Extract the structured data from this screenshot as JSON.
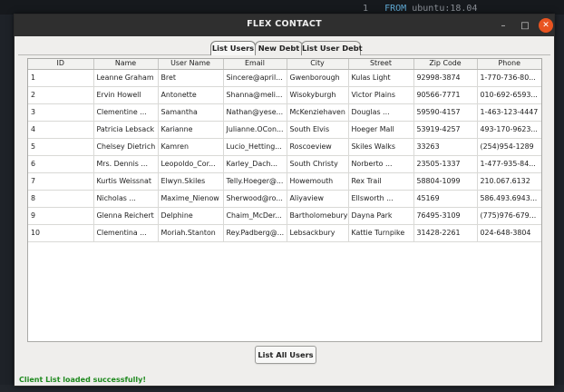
{
  "background": {
    "terminal_line_number": "1",
    "terminal_keyword": "FROM",
    "terminal_text": "ubuntu:18.04"
  },
  "window": {
    "title": "FLEX CONTACT",
    "minimize_label": "–",
    "maximize_label": "□",
    "close_label": "✕"
  },
  "tabs": [
    {
      "label": "List Users",
      "active": true
    },
    {
      "label": "New Debt",
      "active": false
    },
    {
      "label": "List User Debt",
      "active": false
    }
  ],
  "table": {
    "columns": [
      "ID",
      "Name",
      "User Name",
      "Email",
      "City",
      "Street",
      "Zip Code",
      "Phone"
    ],
    "rows": [
      [
        "1",
        "Leanne Graham",
        "Bret",
        "Sincere@april...",
        "Gwenborough",
        "Kulas Light",
        "92998-3874",
        "1-770-736-80..."
      ],
      [
        "2",
        "Ervin Howell",
        "Antonette",
        "Shanna@meli...",
        "Wisokyburgh",
        "Victor Plains",
        "90566-7771",
        "010-692-6593..."
      ],
      [
        "3",
        "Clementine ...",
        "Samantha",
        "Nathan@yese...",
        "McKenziehaven",
        "Douglas ...",
        "59590-4157",
        "1-463-123-4447"
      ],
      [
        "4",
        "Patricia Lebsack",
        "Karianne",
        "Julianne.OCon...",
        "South Elvis",
        "Hoeger Mall",
        "53919-4257",
        "493-170-9623..."
      ],
      [
        "5",
        "Chelsey Dietrich",
        "Kamren",
        "Lucio_Hetting...",
        "Roscoeview",
        "Skiles Walks",
        "33263",
        "(254)954-1289"
      ],
      [
        "6",
        "Mrs. Dennis ...",
        "Leopoldo_Cor...",
        "Karley_Dach...",
        "South Christy",
        "Norberto ...",
        "23505-1337",
        "1-477-935-84..."
      ],
      [
        "7",
        "Kurtis Weissnat",
        "Elwyn.Skiles",
        "Telly.Hoeger@...",
        "Howemouth",
        "Rex Trail",
        "58804-1099",
        "210.067.6132"
      ],
      [
        "8",
        "Nicholas ...",
        "Maxime_Nienow",
        "Sherwood@ro...",
        "Aliyaview",
        "Ellsworth ...",
        "45169",
        "586.493.6943..."
      ],
      [
        "9",
        "Glenna Reichert",
        "Delphine",
        "Chaim_McDer...",
        "Bartholomebury",
        "Dayna Park",
        "76495-3109",
        "(775)976-679..."
      ],
      [
        "10",
        "Clementina ...",
        "Moriah.Stanton",
        "Rey.Padberg@...",
        "Lebsackbury",
        "Kattie Turnpike",
        "31428-2261",
        "024-648-3804"
      ]
    ]
  },
  "list_all_button": {
    "label": "List All Users"
  },
  "status": {
    "message": "Client List loaded successfully!",
    "color": "#1f8a1f"
  }
}
